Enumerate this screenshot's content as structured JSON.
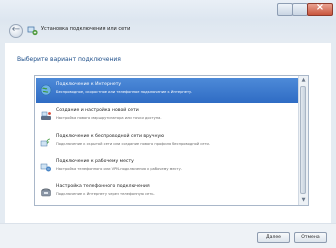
{
  "window": {
    "title": "Установка подключения или сети"
  },
  "instruction": "Выберите вариант подключения",
  "options": [
    {
      "title": "Подключение к Интернету",
      "desc": "Беспроводное, скоростное или телефонное подключение к Интернету.",
      "icon": "globe-icon"
    },
    {
      "title": "Создание и настройка новой сети",
      "desc": "Настройка нового маршрутизатора или точки доступа.",
      "icon": "router-icon"
    },
    {
      "title": "Подключение к беспроводной сети вручную",
      "desc": "Подключение к скрытой сети или создание нового профиля беспроводной сети.",
      "icon": "wireless-icon"
    },
    {
      "title": "Подключение к рабочему месту",
      "desc": "Настройка телефонного или VPN-подключения к рабочему месту.",
      "icon": "workplace-icon"
    },
    {
      "title": "Настройка телефонного подключения",
      "desc": "Подключение к Интернету через телефонную сеть.",
      "icon": "phone-icon"
    }
  ],
  "selected_index": 0,
  "buttons": {
    "next": "Далее",
    "cancel": "Отмена"
  }
}
